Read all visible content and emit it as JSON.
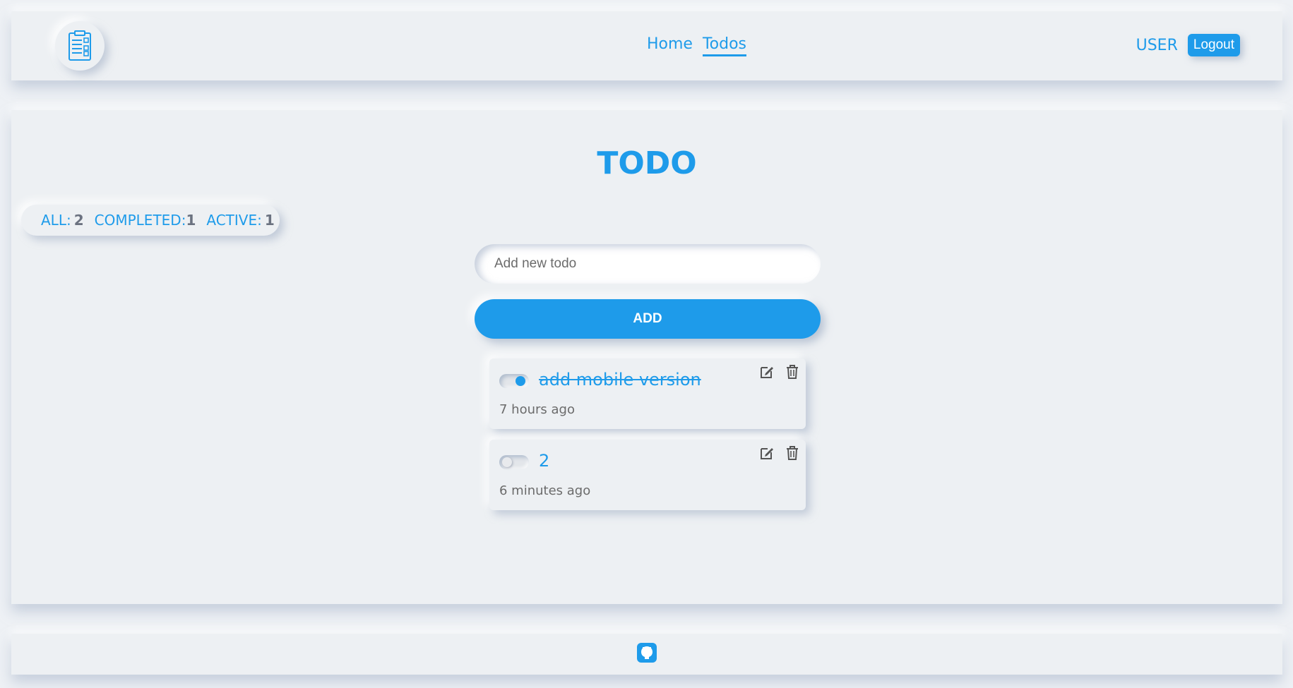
{
  "header": {
    "logo_icon": "clipboard-list-icon",
    "nav": [
      {
        "label": "Home",
        "active": false
      },
      {
        "label": "Todos",
        "active": true
      }
    ],
    "user_label": "USER",
    "logout_label": "Logout"
  },
  "main": {
    "title": "TODO",
    "counters": {
      "all_label": "ALL:",
      "all_count": "2",
      "completed_label": "COMPLETED:",
      "completed_count": "1",
      "active_label": "ACTIVE:",
      "active_count": "1"
    },
    "input_placeholder": "Add new todo",
    "add_label": "ADD",
    "todos": [
      {
        "text": "add mobile version",
        "completed": true,
        "time": "7 hours ago"
      },
      {
        "text": "2",
        "completed": false,
        "time": "6 minutes ago"
      }
    ]
  },
  "footer": {
    "icon": "github-icon"
  },
  "colors": {
    "accent": "#1e9bea",
    "background": "#edf0f3",
    "muted": "#6b6b6b"
  }
}
